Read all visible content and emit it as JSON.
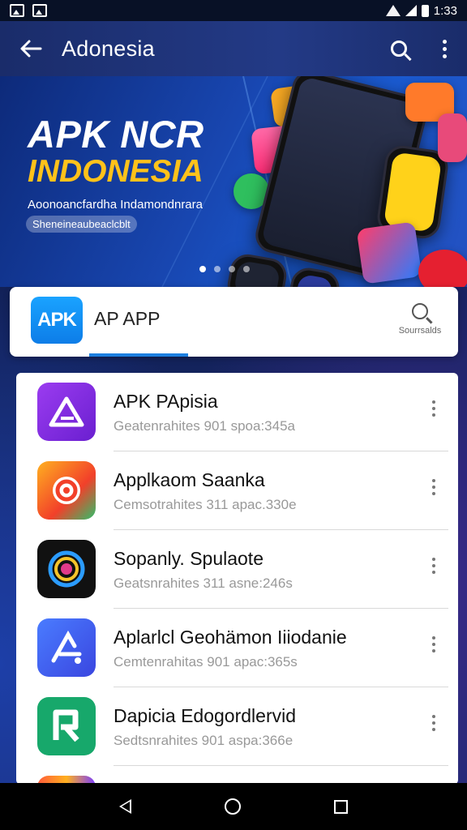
{
  "status_bar": {
    "time": "1:33"
  },
  "app_bar": {
    "title": "Adonesia"
  },
  "banner": {
    "title_line1": "APK NCR",
    "title_line2": "INDONESIA",
    "subtitle": "Aoonoancfardha Indamondnrara",
    "pill": "Sheneineaubeaclcblt",
    "page_indicator": {
      "count": 4,
      "active": 0
    }
  },
  "search": {
    "logo_text": "APK",
    "query": "AP APP",
    "action_label": "Sourrsalds"
  },
  "apps": [
    {
      "name": "APK PApisia",
      "meta": "Geatenrahites 901 spoa:345a",
      "icon": "triangle-logo-icon",
      "color": "#8a2be2"
    },
    {
      "name": "Applkaom Saanka",
      "meta": "Cemsotrahites 311 apac.330e",
      "icon": "target-ring-icon",
      "color": "#f25a2a"
    },
    {
      "name": "Sopanly. Spulaote",
      "meta": "Geatsnrahites 311 asne:246s",
      "icon": "swirl-circle-icon",
      "color": "#111111"
    },
    {
      "name": "Aplarlcl Geohämon Iiiodanie",
      "meta": "Cemtenrahitas 901 apac:365s",
      "icon": "leaf-a-icon",
      "color": "#3a5cf0"
    },
    {
      "name": "Dapicia Edogordlervid",
      "meta": "Sedtsnrahites 901 aspa:366e",
      "icon": "letter-a-icon",
      "color": "#17a86b"
    },
    {
      "name": "",
      "meta": "",
      "icon": "partial-app-icon",
      "color": "#f2a33a"
    }
  ]
}
